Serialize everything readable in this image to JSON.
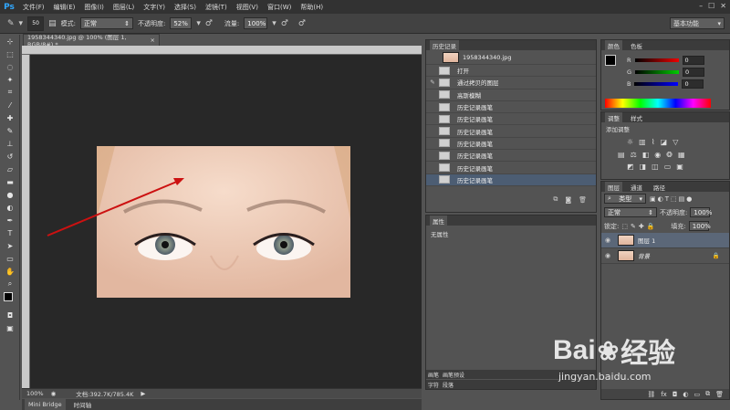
{
  "app": {
    "logo": "Ps"
  },
  "menu": [
    "文件(F)",
    "编辑(E)",
    "图像(I)",
    "图层(L)",
    "文字(Y)",
    "选择(S)",
    "滤镜(T)",
    "视图(V)",
    "窗口(W)",
    "帮助(H)"
  ],
  "options": {
    "brush_size": "50",
    "mode_label": "模式:",
    "mode_value": "正常",
    "opacity_label": "不透明度:",
    "opacity_value": "52%",
    "flow_label": "流量:",
    "flow_value": "100%"
  },
  "workspace": "基本功能",
  "document": {
    "tab_title": "1958344340.jpg @ 100% (图层 1, RGB/8#) *",
    "zoom": "100%",
    "doc_info": "文档:392.7K/785.4K"
  },
  "bottom_tabs": [
    "Mini Bridge",
    "时间轴"
  ],
  "history": {
    "title": "历史记录",
    "snapshot": "1958344340.jpg",
    "items": [
      "打开",
      "通过拷贝的图层",
      "高斯模糊",
      "历史记录画笔",
      "历史记录画笔",
      "历史记录画笔",
      "历史记录画笔",
      "历史记录画笔",
      "历史记录画笔",
      "历史记录画笔"
    ]
  },
  "properties": {
    "title": "属性",
    "empty": "无属性"
  },
  "panel_bottom_tabs": [
    "画笔",
    "画笔预设"
  ],
  "panel_bottom_tabs2": [
    "字符",
    "段落"
  ],
  "color_panel": {
    "tabs": [
      "颜色",
      "色板"
    ],
    "r_label": "R",
    "g_label": "G",
    "b_label": "B",
    "r": "0",
    "g": "0",
    "b": "0"
  },
  "adjustments": {
    "tabs": [
      "调整",
      "样式"
    ],
    "add_label": "添加调整"
  },
  "layers": {
    "tabs": [
      "图层",
      "通道",
      "路径"
    ],
    "kind": "类型",
    "blend": "正常",
    "opacity_label": "不透明度:",
    "opacity_value": "100%",
    "lock_label": "锁定:",
    "fill_label": "填充:",
    "fill_value": "100%",
    "rows": [
      "图层 1",
      "背景"
    ]
  },
  "watermark": {
    "brand": "Bai",
    "brand2": "经验",
    "url": "jingyan.baidu.com"
  },
  "colors": {
    "accent": "#31a8ff",
    "arrow": "#cc1111",
    "selection": "#5b6778"
  }
}
